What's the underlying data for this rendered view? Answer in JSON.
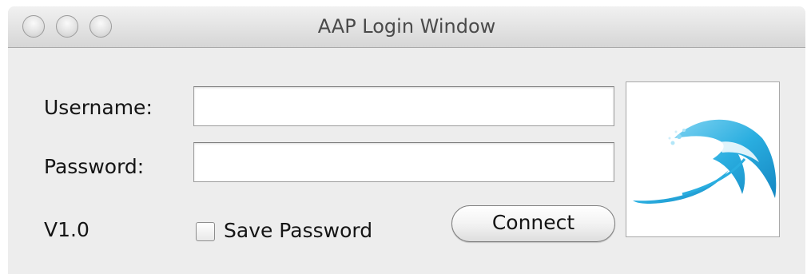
{
  "window": {
    "title": "AAP Login Window"
  },
  "form": {
    "username_label": "Username:",
    "username_value": "",
    "password_label": "Password:",
    "password_value": "",
    "version_label": "V1.0",
    "save_password_label": "Save Password",
    "save_password_checked": false,
    "connect_label": "Connect"
  },
  "logo": {
    "icon": "wave-logo-icon",
    "color": "#2aaee0"
  }
}
